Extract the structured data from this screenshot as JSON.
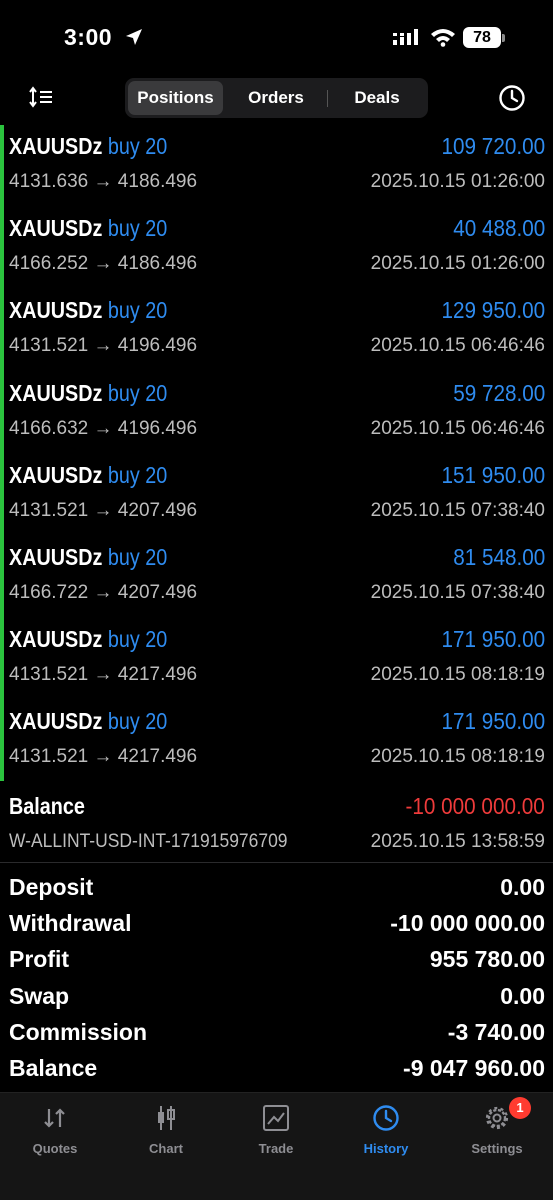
{
  "status_bar": {
    "time": "3:00",
    "battery": "78"
  },
  "tabs_top": [
    "Positions",
    "Orders",
    "Deals"
  ],
  "deals": [
    {
      "symbol": "XAUUSDz",
      "direction": "buy 20",
      "profit": "109 720.00",
      "prices": "4131.636 → 4186.496",
      "datetime": "2025.10.15 01:26:00"
    },
    {
      "symbol": "XAUUSDz",
      "direction": "buy 20",
      "profit": "40 488.00",
      "prices": "4166.252 → 4186.496",
      "datetime": "2025.10.15 01:26:00"
    },
    {
      "symbol": "XAUUSDz",
      "direction": "buy 20",
      "profit": "129 950.00",
      "prices": "4131.521 → 4196.496",
      "datetime": "2025.10.15 06:46:46"
    },
    {
      "symbol": "XAUUSDz",
      "direction": "buy 20",
      "profit": "59 728.00",
      "prices": "4166.632 → 4196.496",
      "datetime": "2025.10.15 06:46:46"
    },
    {
      "symbol": "XAUUSDz",
      "direction": "buy 20",
      "profit": "151 950.00",
      "prices": "4131.521 → 4207.496",
      "datetime": "2025.10.15 07:38:40"
    },
    {
      "symbol": "XAUUSDz",
      "direction": "buy 20",
      "profit": "81 548.00",
      "prices": "4166.722 → 4207.496",
      "datetime": "2025.10.15 07:38:40"
    },
    {
      "symbol": "XAUUSDz",
      "direction": "buy 20",
      "profit": "171 950.00",
      "prices": "4131.521 → 4217.496",
      "datetime": "2025.10.15 08:18:19"
    },
    {
      "symbol": "XAUUSDz",
      "direction": "buy 20",
      "profit": "171 950.00",
      "prices": "4131.521 → 4217.496",
      "datetime": "2025.10.15 08:18:19"
    }
  ],
  "balance_operation": {
    "label": "Balance",
    "amount": "-10 000 000.00",
    "comment": "W-ALLINT-USD-INT-171915976709",
    "datetime": "2025.10.15 13:58:59"
  },
  "summary": {
    "deposit_label": "Deposit",
    "deposit": "0.00",
    "withdrawal_label": "Withdrawal",
    "withdrawal": "-10 000 000.00",
    "profit_label": "Profit",
    "profit": "955 780.00",
    "swap_label": "Swap",
    "swap": "0.00",
    "commission_label": "Commission",
    "commission": "-3 740.00",
    "balance_label": "Balance",
    "balance": "-9 047 960.00"
  },
  "tab_bar": {
    "quotes": "Quotes",
    "chart": "Chart",
    "trade": "Trade",
    "history": "History",
    "settings": "Settings",
    "settings_badge": "1"
  },
  "colors": {
    "accent": "#2f8cf0",
    "loss": "#ef3b3b",
    "position_marker": "#2bc33e",
    "background": "#000000"
  }
}
